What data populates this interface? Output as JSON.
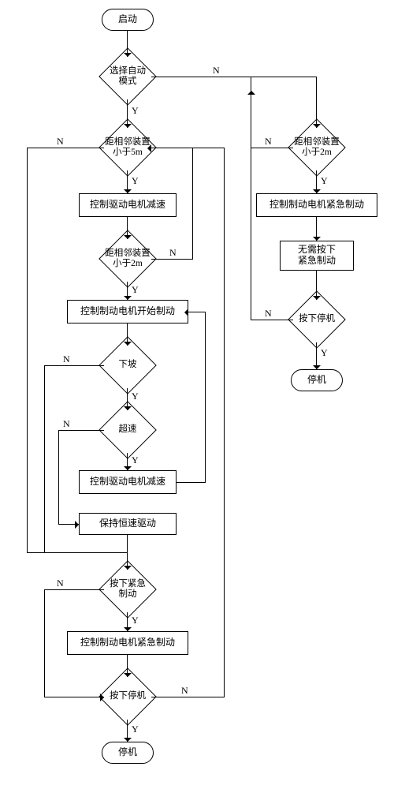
{
  "labels": {
    "Y": "Y",
    "N": "N"
  },
  "nodes": {
    "start": "启动",
    "select_auto_mode": "选择自动\n模式",
    "dist_lt_5m": "距相邻装置\n小于5m",
    "ctrl_drive_decel": "控制驱动电机减速",
    "dist_lt_2m_left": "距相邻装置\n小于2m",
    "ctrl_brake_start": "控制制动电机开始制动",
    "downhill": "下坡",
    "overspeed": "超速",
    "ctrl_drive_decel_2": "控制驱动电机减速",
    "keep_const_speed": "保持恒速驱动",
    "press_emerg_brake": "按下紧急\n制动",
    "ctrl_brake_emerg_left": "控制制动电机紧急制动",
    "press_stop_left": "按下停机",
    "stop_left": "停机",
    "dist_lt_2m_right": "距相邻装置\n小于2m",
    "ctrl_brake_emerg_right": "控制制动电机紧急制动",
    "no_need_press_emerg": "无需按下\n紧急制动",
    "press_stop_right": "按下停机",
    "stop_right": "停机"
  },
  "chart_data": {
    "type": "flowchart",
    "nodes": [
      {
        "id": "start",
        "kind": "terminator",
        "text": "启动"
      },
      {
        "id": "select_auto_mode",
        "kind": "decision",
        "text": "选择自动模式"
      },
      {
        "id": "dist_lt_5m",
        "kind": "decision",
        "text": "距相邻装置小于5m"
      },
      {
        "id": "ctrl_drive_decel",
        "kind": "process",
        "text": "控制驱动电机减速"
      },
      {
        "id": "dist_lt_2m_left",
        "kind": "decision",
        "text": "距相邻装置小于2m"
      },
      {
        "id": "ctrl_brake_start",
        "kind": "process",
        "text": "控制制动电机开始制动"
      },
      {
        "id": "downhill",
        "kind": "decision",
        "text": "下坡"
      },
      {
        "id": "overspeed",
        "kind": "decision",
        "text": "超速"
      },
      {
        "id": "ctrl_drive_decel_2",
        "kind": "process",
        "text": "控制驱动电机减速"
      },
      {
        "id": "keep_const_speed",
        "kind": "process",
        "text": "保持恒速驱动"
      },
      {
        "id": "press_emerg_brake",
        "kind": "decision",
        "text": "按下紧急制动"
      },
      {
        "id": "ctrl_brake_emerg_left",
        "kind": "process",
        "text": "控制制动电机紧急制动"
      },
      {
        "id": "press_stop_left",
        "kind": "decision",
        "text": "按下停机"
      },
      {
        "id": "stop_left",
        "kind": "terminator",
        "text": "停机"
      },
      {
        "id": "dist_lt_2m_right",
        "kind": "decision",
        "text": "距相邻装置小于2m"
      },
      {
        "id": "ctrl_brake_emerg_right",
        "kind": "process",
        "text": "控制制动电机紧急制动"
      },
      {
        "id": "no_need_press_emerg",
        "kind": "process",
        "text": "无需按下紧急制动"
      },
      {
        "id": "press_stop_right",
        "kind": "decision",
        "text": "按下停机"
      },
      {
        "id": "stop_right",
        "kind": "terminator",
        "text": "停机"
      }
    ],
    "edges": [
      {
        "from": "start",
        "to": "select_auto_mode"
      },
      {
        "from": "select_auto_mode",
        "to": "dist_lt_5m",
        "label": "Y"
      },
      {
        "from": "select_auto_mode",
        "to": "dist_lt_2m_right",
        "label": "N"
      },
      {
        "from": "dist_lt_5m",
        "to": "ctrl_drive_decel",
        "label": "Y"
      },
      {
        "from": "dist_lt_5m",
        "to": "press_emerg_brake",
        "label": "N"
      },
      {
        "from": "ctrl_drive_decel",
        "to": "dist_lt_2m_left"
      },
      {
        "from": "dist_lt_2m_left",
        "to": "ctrl_brake_start",
        "label": "Y"
      },
      {
        "from": "dist_lt_2m_left",
        "to": "dist_lt_5m",
        "label": "N"
      },
      {
        "from": "ctrl_brake_start",
        "to": "downhill"
      },
      {
        "from": "downhill",
        "to": "overspeed",
        "label": "Y"
      },
      {
        "from": "downhill",
        "to": "press_emerg_brake",
        "label": "N"
      },
      {
        "from": "overspeed",
        "to": "ctrl_drive_decel_2",
        "label": "Y"
      },
      {
        "from": "overspeed",
        "to": "keep_const_speed",
        "label": "N"
      },
      {
        "from": "ctrl_drive_decel_2",
        "to": "ctrl_brake_start"
      },
      {
        "from": "keep_const_speed",
        "to": "press_emerg_brake"
      },
      {
        "from": "press_emerg_brake",
        "to": "ctrl_brake_emerg_left",
        "label": "Y"
      },
      {
        "from": "press_emerg_brake",
        "to": "press_stop_left",
        "label": "N"
      },
      {
        "from": "ctrl_brake_emerg_left",
        "to": "press_stop_left"
      },
      {
        "from": "press_stop_left",
        "to": "stop_left",
        "label": "Y"
      },
      {
        "from": "press_stop_left",
        "to": "dist_lt_5m",
        "label": "N"
      },
      {
        "from": "dist_lt_2m_right",
        "to": "ctrl_brake_emerg_right",
        "label": "Y"
      },
      {
        "from": "dist_lt_2m_right",
        "to": "select_auto_mode",
        "label": "N"
      },
      {
        "from": "ctrl_brake_emerg_right",
        "to": "no_need_press_emerg"
      },
      {
        "from": "no_need_press_emerg",
        "to": "press_stop_right"
      },
      {
        "from": "press_stop_right",
        "to": "stop_right",
        "label": "Y"
      },
      {
        "from": "press_stop_right",
        "to": "dist_lt_2m_right",
        "label": "N"
      }
    ]
  }
}
